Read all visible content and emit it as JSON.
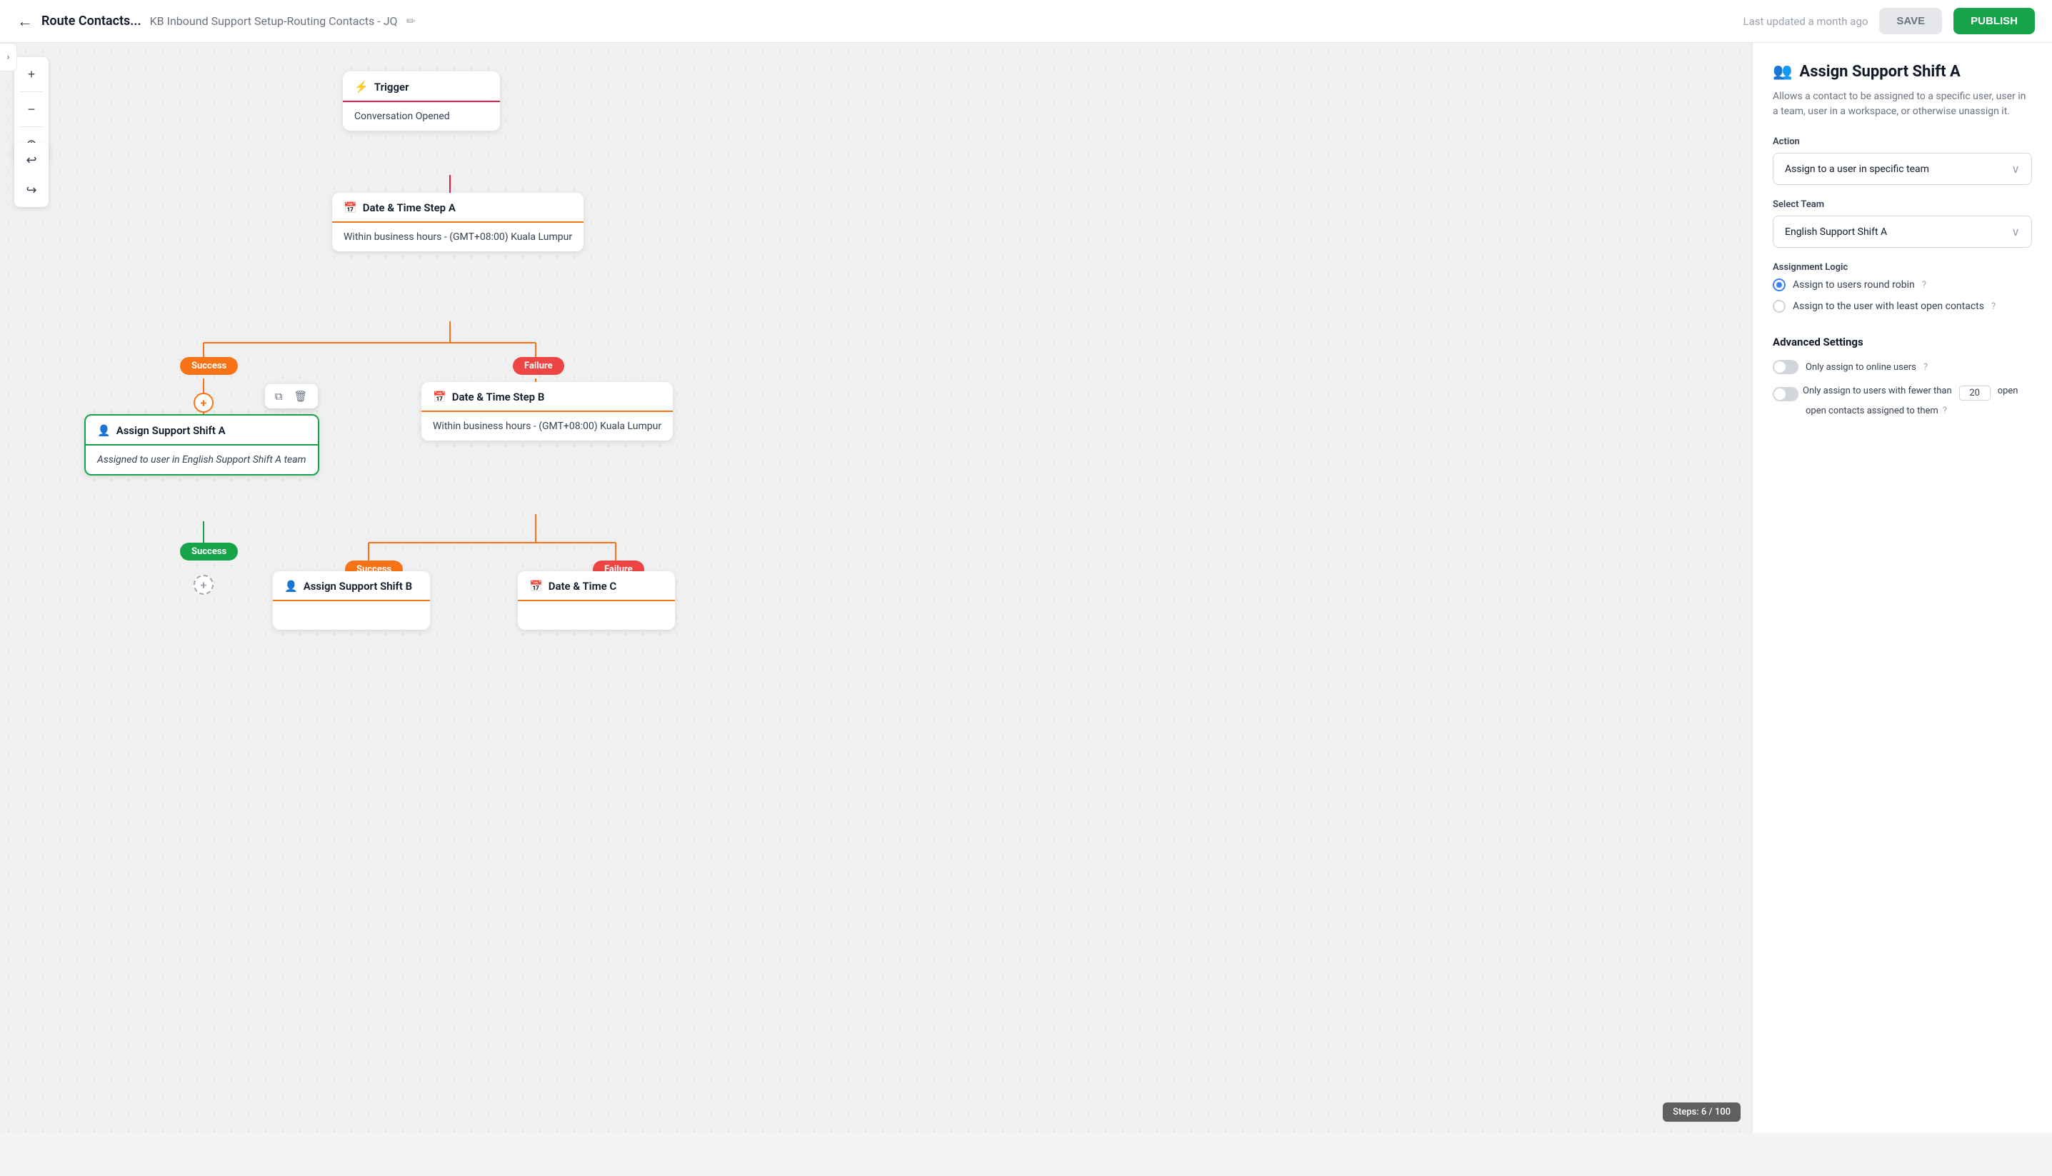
{
  "topbar": {
    "back_label": "←",
    "title": "Route Contacts...",
    "breadcrumb_sep": "",
    "subtitle": "KB Inbound Support Setup-Routing Contacts - JQ",
    "edit_icon": "✏",
    "last_updated": "Last updated a month ago",
    "save_label": "SAVE",
    "publish_label": "PUBLISH"
  },
  "canvas": {
    "controls": {
      "zoom_in": "+",
      "zoom_out": "−",
      "center": "⊕",
      "undo": "↩",
      "redo": "↪"
    },
    "steps": "Steps: 6 / 100"
  },
  "nodes": {
    "trigger": {
      "icon": "⚡",
      "title": "Trigger",
      "body": "Conversation Opened"
    },
    "datetime_a": {
      "icon": "📅",
      "title": "Date & Time Step A",
      "body": "Within business hours - (GMT+08:00) Kuala Lumpur"
    },
    "assign_a": {
      "icon": "👤",
      "title": "Assign Support Shift A",
      "body": "Assigned to user in English Support Shift A team"
    },
    "datetime_b": {
      "icon": "📅",
      "title": "Date & Time Step B",
      "body": "Within business hours - (GMT+08:00) Kuala Lumpur"
    },
    "assign_b": {
      "icon": "👤",
      "title": "Assign Support Shift B",
      "body": ""
    },
    "datetime_c": {
      "icon": "📅",
      "title": "Date & Time C",
      "body": ""
    }
  },
  "badges": {
    "success": "Success",
    "failure": "Failure"
  },
  "right_panel": {
    "icon": "👥",
    "title": "Assign Support Shift A",
    "description": "Allows a contact to be assigned to a specific user, user in a team, user in a workspace, or otherwise unassign it.",
    "action_label": "Action",
    "action_value": "Assign to a user in specific team",
    "team_label": "Select Team",
    "team_value": "English Support Shift A",
    "assignment_logic_label": "Assignment Logic",
    "radio_round_robin": "Assign to users round robin",
    "radio_least_open": "Assign to the user with least open contacts",
    "advanced_label": "Advanced Settings",
    "toggle_online_label": "Only assign to online users",
    "toggle_fewer_label": "Only assign to users with fewer than",
    "toggle_fewer_count": "20",
    "toggle_fewer_suffix": "open contacts assigned to them"
  }
}
